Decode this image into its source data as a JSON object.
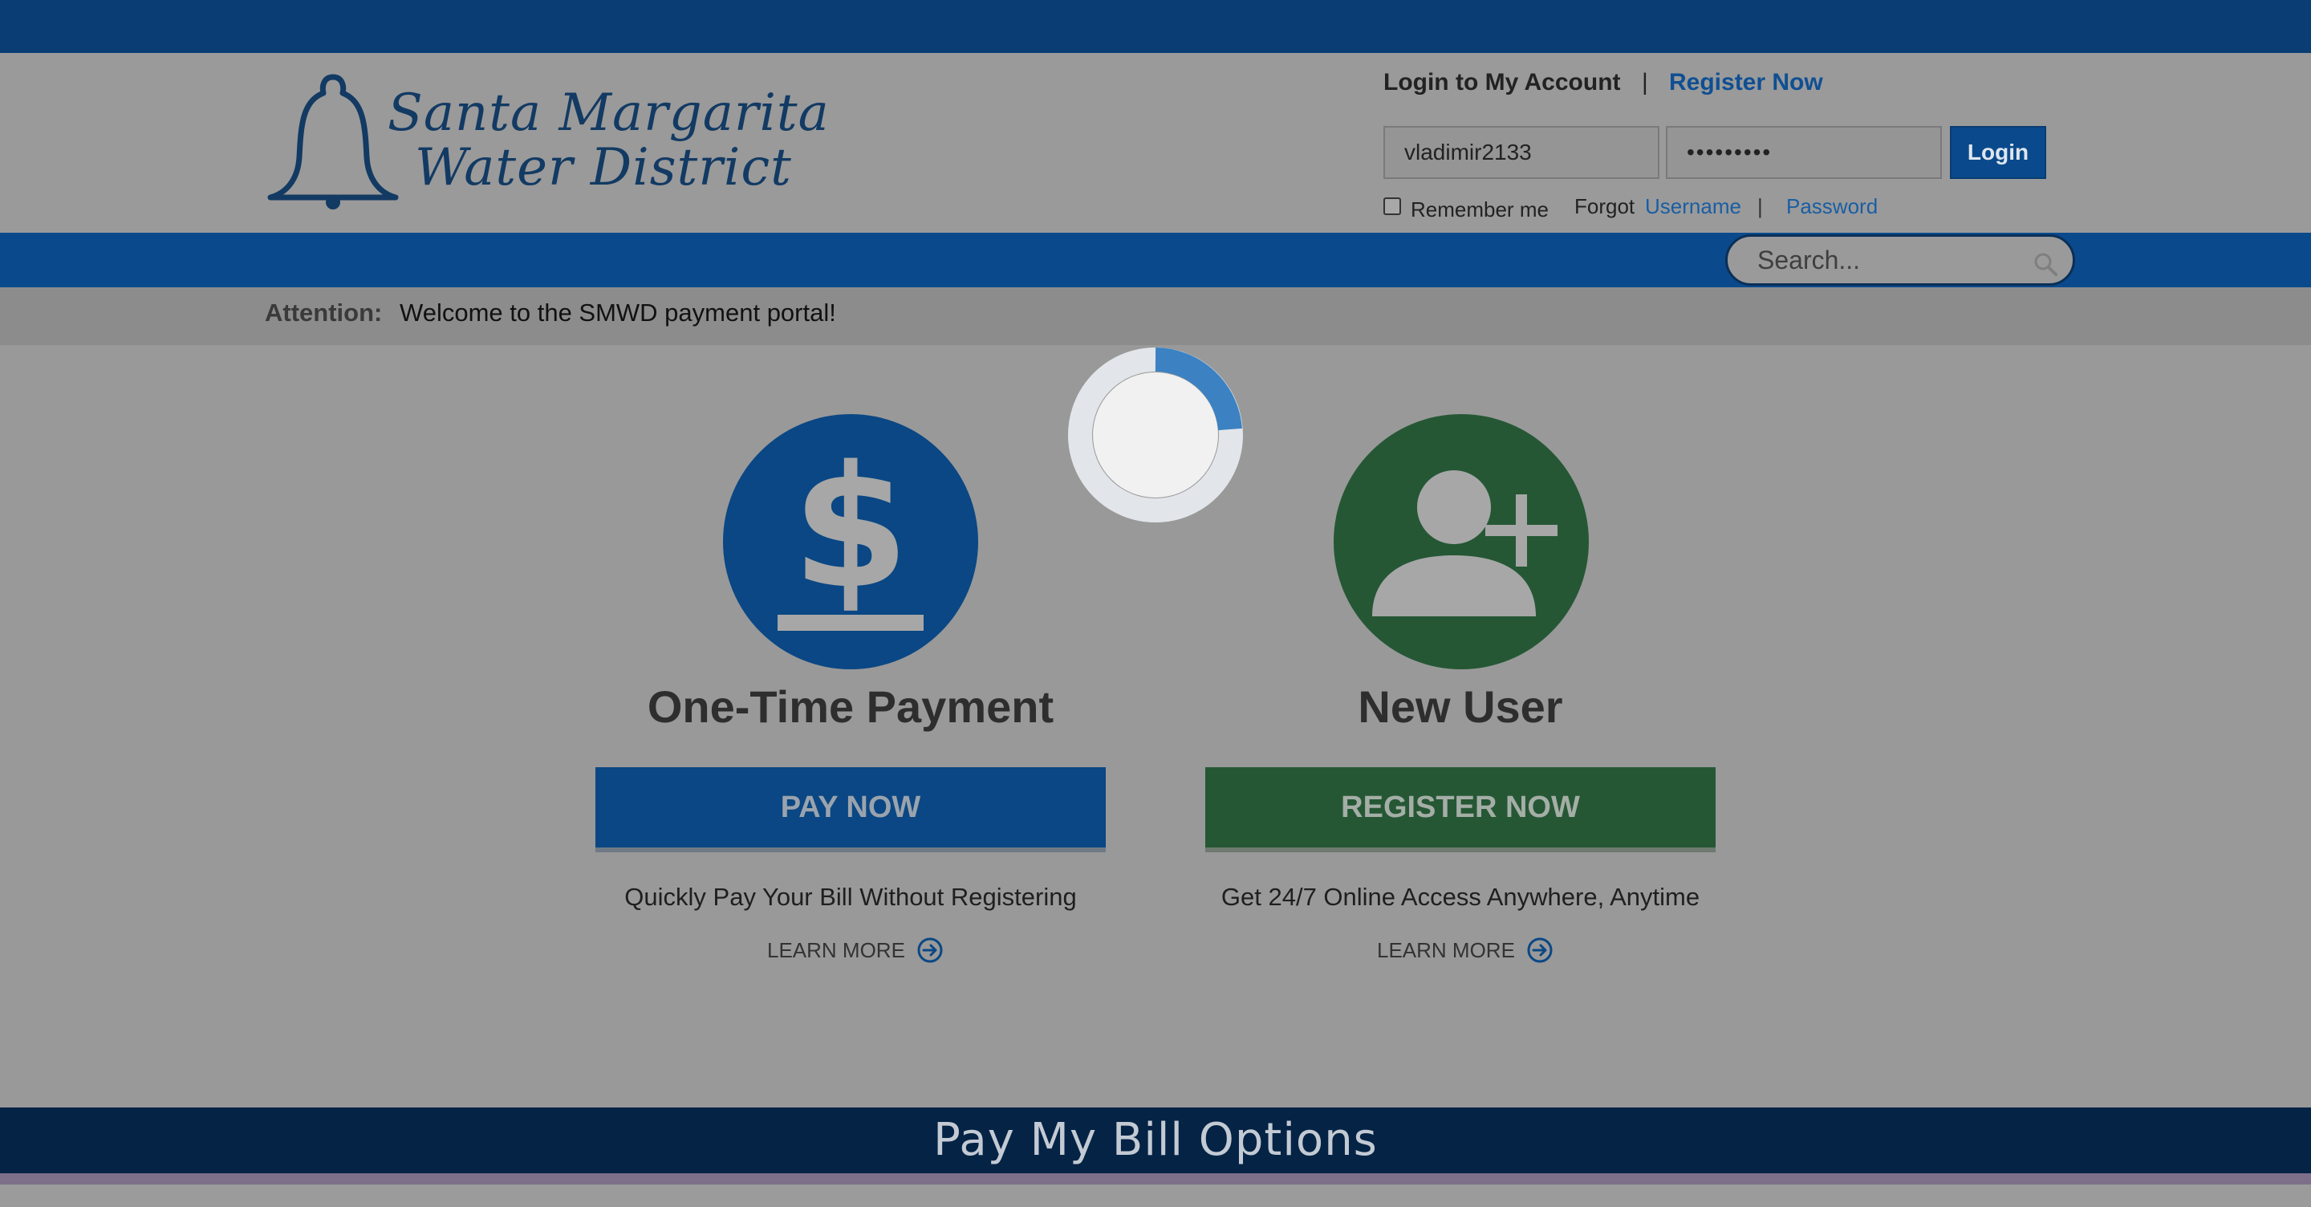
{
  "header": {
    "logo_line1": "Santa Margarita",
    "logo_line2": "Water District",
    "login_title": "Login to My Account",
    "separator": "|",
    "register_link": "Register Now",
    "username_value": "vladimir2133",
    "password_value": "•••••••••",
    "login_button": "Login",
    "remember_label": "Remember me",
    "forgot_label": "Forgot",
    "forgot_username": "Username",
    "forgot_separator": "|",
    "forgot_password": "Password"
  },
  "nav": {
    "search_placeholder": "Search..."
  },
  "attention": {
    "label": "Attention:",
    "message": "Welcome to the SMWD payment portal!"
  },
  "cards": [
    {
      "icon": "dollar-icon",
      "title": "One-Time Payment",
      "button": "PAY NOW",
      "description": "Quickly Pay Your Bill Without Registering",
      "learn_more": "LEARN MORE"
    },
    {
      "icon": "add-user-icon",
      "title": "New User",
      "button": "REGISTER NOW",
      "description": "Get 24/7 Online Access Anywhere, Anytime",
      "learn_more": "LEARN MORE"
    }
  ],
  "footer": {
    "title": "Pay My Bill Options"
  },
  "colors": {
    "primary_blue": "#0a4784",
    "green": "#255734",
    "overlay_gray": "#999999"
  }
}
